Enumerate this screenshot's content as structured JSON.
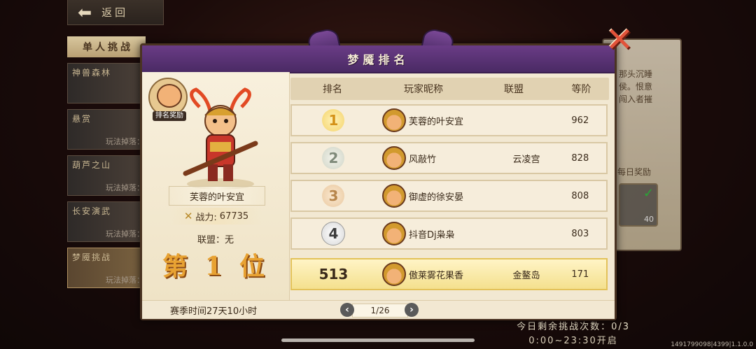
{
  "back": {
    "label": "返回"
  },
  "sidebar": {
    "header": "单人挑战",
    "items": [
      {
        "label": "神兽森林",
        "drop": ""
      },
      {
        "label": "悬赏",
        "drop": "玩法掉落："
      },
      {
        "label": "葫芦之山",
        "drop": "玩法掉落："
      },
      {
        "label": "长安演武",
        "drop": "玩法掉落："
      },
      {
        "label": "梦魇挑战",
        "drop": "玩法掉落："
      }
    ]
  },
  "right_panel": {
    "text": [
      "那头沉睡",
      "侯。恨意",
      "闯入者摧"
    ],
    "reward_title": "每日奖励",
    "item_count": "40"
  },
  "modal": {
    "title": "梦魇排名",
    "badge_label": "排名奖励",
    "player": {
      "name": "芙蓉的叶安宜",
      "power_label": "战力:",
      "power_value": "67735",
      "alliance": "联盟：无",
      "rank_text": "第 1 位"
    },
    "columns": [
      "排名",
      "玩家昵称",
      "联盟",
      "等阶"
    ],
    "rows": [
      {
        "rank": "1",
        "name": "芙蓉的叶安宜",
        "alliance": "",
        "level": "962"
      },
      {
        "rank": "2",
        "name": "风敲竹",
        "alliance": "云凌宫",
        "level": "828"
      },
      {
        "rank": "3",
        "name": "御虚的徐安晏",
        "alliance": "",
        "level": "808"
      },
      {
        "rank": "4",
        "name": "抖音Dj枭枭",
        "alliance": "",
        "level": "803"
      },
      {
        "rank": "513",
        "name": "傲莱雾花果香",
        "alliance": "金鳌岛",
        "level": "171"
      }
    ],
    "season": "赛季时间27天10小时",
    "page": "1/26"
  },
  "bottom": {
    "challenges": "今日剩余挑战次数：0/3",
    "hours": "0:00~23:30开启"
  },
  "version": "1491799098|4399|1.1.0.0"
}
